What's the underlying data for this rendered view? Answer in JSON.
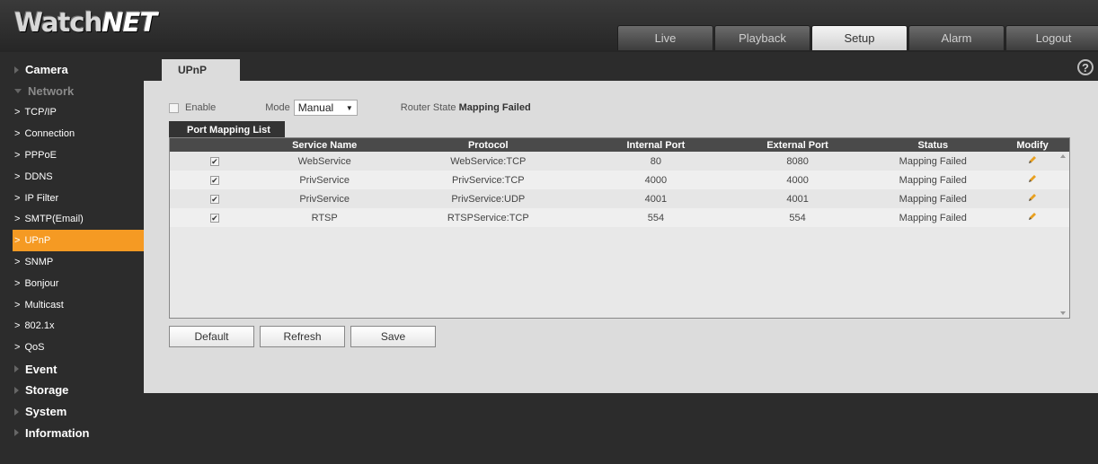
{
  "header": {
    "logo_main": "Watch",
    "logo_accent": "NET",
    "tabs": [
      {
        "label": "Live"
      },
      {
        "label": "Playback"
      },
      {
        "label": "Setup"
      },
      {
        "label": "Alarm"
      },
      {
        "label": "Logout"
      }
    ],
    "active_tab": "Setup"
  },
  "sidebar": {
    "camera": "Camera",
    "network": "Network",
    "network_items": [
      {
        "label": "TCP/IP"
      },
      {
        "label": "Connection"
      },
      {
        "label": "PPPoE"
      },
      {
        "label": "DDNS"
      },
      {
        "label": "IP Filter"
      },
      {
        "label": "SMTP(Email)"
      },
      {
        "label": "UPnP"
      },
      {
        "label": "SNMP"
      },
      {
        "label": "Bonjour"
      },
      {
        "label": "Multicast"
      },
      {
        "label": "802.1x"
      },
      {
        "label": "QoS"
      }
    ],
    "active_item": "UPnP",
    "event": "Event",
    "storage": "Storage",
    "system": "System",
    "information": "Information",
    "chevron": ">"
  },
  "content": {
    "page_tab": "UPnP",
    "help_icon": "?",
    "enable_label": "Enable",
    "mode_label": "Mode",
    "mode_value": "Manual",
    "router_state_label": "Router State",
    "router_state_value": "Mapping Failed",
    "subtab": "Port Mapping List",
    "columns": [
      "",
      "Service Name",
      "Protocol",
      "Internal Port",
      "External Port",
      "Status",
      "Modify"
    ],
    "rows": [
      {
        "checked": "✔",
        "service": "WebService",
        "protocol": "WebService:TCP",
        "internal": "80",
        "external": "8080",
        "status": "Mapping Failed"
      },
      {
        "checked": "✔",
        "service": "PrivService",
        "protocol": "PrivService:TCP",
        "internal": "4000",
        "external": "4000",
        "status": "Mapping Failed"
      },
      {
        "checked": "✔",
        "service": "PrivService",
        "protocol": "PrivService:UDP",
        "internal": "4001",
        "external": "4001",
        "status": "Mapping Failed"
      },
      {
        "checked": "✔",
        "service": "RTSP",
        "protocol": "RTSPService:TCP",
        "internal": "554",
        "external": "554",
        "status": "Mapping Failed"
      }
    ],
    "buttons": {
      "default": "Default",
      "refresh": "Refresh",
      "save": "Save"
    }
  },
  "colors": {
    "accent": "#f59a23",
    "pencil": "#e8a020"
  }
}
